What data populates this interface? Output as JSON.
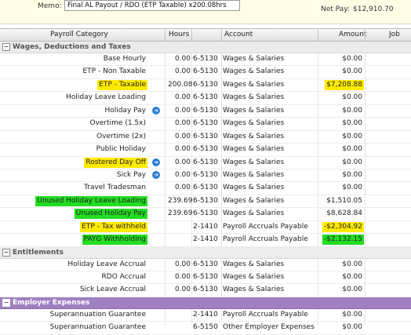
{
  "memo": {
    "label": "Memo:",
    "value": "Final AL Payout / RDO (ETP Taxable) x200.08hrs"
  },
  "net_pay": {
    "label": "Net Pay:",
    "value": "$12,910.70"
  },
  "columns": [
    "Payroll Category",
    "Hours",
    "Account",
    "Amount",
    "Job"
  ],
  "sections": [
    {
      "title": "Wages, Deductions and Taxes",
      "toggle": "−",
      "rows": [
        {
          "category": "Base Hourly",
          "hours": "0.00",
          "acct_no": "6-5130",
          "acct_name": "Wages & Salaries",
          "amount": "$0.00",
          "cat_hl": "",
          "amt_hl": "",
          "info": false
        },
        {
          "category": "ETP - Non Taxable",
          "hours": "0.00",
          "acct_no": "6-5130",
          "acct_name": "Wages & Salaries",
          "amount": "$0.00",
          "cat_hl": "",
          "amt_hl": "",
          "info": false
        },
        {
          "category": "ETP - Taxable",
          "hours": "200.08",
          "acct_no": "6-5130",
          "acct_name": "Wages & Salaries",
          "amount": "$7,208.88",
          "cat_hl": "yellow",
          "amt_hl": "yellow",
          "info": false
        },
        {
          "category": "Holiday Leave Loading",
          "hours": "0.00",
          "acct_no": "6-5130",
          "acct_name": "Wages & Salaries",
          "amount": "$0.00",
          "cat_hl": "",
          "amt_hl": "",
          "info": false
        },
        {
          "category": "Holiday Pay",
          "hours": "0.00",
          "acct_no": "6-5130",
          "acct_name": "Wages & Salaries",
          "amount": "$0.00",
          "cat_hl": "",
          "amt_hl": "",
          "info": true
        },
        {
          "category": "Overtime (1.5x)",
          "hours": "0.00",
          "acct_no": "6-5130",
          "acct_name": "Wages & Salaries",
          "amount": "$0.00",
          "cat_hl": "",
          "amt_hl": "",
          "info": false
        },
        {
          "category": "Overtime (2x)",
          "hours": "0.00",
          "acct_no": "6-5130",
          "acct_name": "Wages & Salaries",
          "amount": "$0.00",
          "cat_hl": "",
          "amt_hl": "",
          "info": false
        },
        {
          "category": "Public Holiday",
          "hours": "0.00",
          "acct_no": "6-5130",
          "acct_name": "Wages & Salaries",
          "amount": "$0.00",
          "cat_hl": "",
          "amt_hl": "",
          "info": false
        },
        {
          "category": "Rostered Day Off",
          "hours": "0.00",
          "acct_no": "6-5130",
          "acct_name": "Wages & Salaries",
          "amount": "$0.00",
          "cat_hl": "yellow",
          "amt_hl": "",
          "info": true
        },
        {
          "category": "Sick Pay",
          "hours": "0.00",
          "acct_no": "6-5130",
          "acct_name": "Wages & Salaries",
          "amount": "$0.00",
          "cat_hl": "",
          "amt_hl": "",
          "info": true
        },
        {
          "category": "Travel Tradesman",
          "hours": "0.00",
          "acct_no": "6-5130",
          "acct_name": "Wages & Salaries",
          "amount": "$0.00",
          "cat_hl": "",
          "amt_hl": "",
          "info": false
        },
        {
          "category": "Unused Holiday Leave Loading",
          "hours": "239.69",
          "acct_no": "6-5130",
          "acct_name": "Wages & Salaries",
          "amount": "$1,510.05",
          "cat_hl": "green",
          "amt_hl": "",
          "info": false
        },
        {
          "category": "Unused Holiday Pay",
          "hours": "239.69",
          "acct_no": "6-5130",
          "acct_name": "Wages & Salaries",
          "amount": "$8,628.84",
          "cat_hl": "green",
          "amt_hl": "",
          "info": false
        },
        {
          "category": "ETP - Tax withheld",
          "hours": "",
          "acct_no": "2-1410",
          "acct_name": "Payroll Accruals Payable",
          "amount": "-$2,304.92",
          "cat_hl": "yellow",
          "amt_hl": "yellow",
          "info": false
        },
        {
          "category": "PAYG Withholding",
          "hours": "",
          "acct_no": "2-1410",
          "acct_name": "Payroll Accruals Payable",
          "amount": "-$2,132.15",
          "cat_hl": "green",
          "amt_hl": "green",
          "info": false
        }
      ]
    },
    {
      "title": "Entitlements",
      "toggle": "−",
      "rows": [
        {
          "category": "Holiday Leave Accrual",
          "hours": "0.00",
          "acct_no": "6-5130",
          "acct_name": "Wages & Salaries",
          "amount": "$0.00",
          "cat_hl": "",
          "amt_hl": "",
          "info": false
        },
        {
          "category": "RDO Accrual",
          "hours": "0.00",
          "acct_no": "6-5130",
          "acct_name": "Wages & Salaries",
          "amount": "$0.00",
          "cat_hl": "",
          "amt_hl": "",
          "info": false
        },
        {
          "category": "Sick Leave Accrual",
          "hours": "0.00",
          "acct_no": "6-5130",
          "acct_name": "Wages & Salaries",
          "amount": "$0.00",
          "cat_hl": "",
          "amt_hl": "",
          "info": false
        }
      ]
    },
    {
      "title": "Employer Expenses",
      "toggle": "−",
      "employer": true,
      "rows": [
        {
          "category": "Superannuation Guarantee",
          "hours": "",
          "acct_no": "2-1410",
          "acct_name": "Payroll Accruals Payable",
          "amount": "$0.00",
          "cat_hl": "",
          "amt_hl": "",
          "info": false
        },
        {
          "category": "Superannuation Guarantee",
          "hours": "",
          "acct_no": "6-5150",
          "acct_name": "Other Employer Expenses",
          "amount": "$0.00",
          "cat_hl": "",
          "amt_hl": "",
          "info": false
        }
      ]
    }
  ],
  "colors": {
    "highlight_yellow": "#ffea00",
    "highlight_green": "#22dd22",
    "employer_section": "#a080c0",
    "info_icon": "#2f7fd0"
  },
  "icons": {
    "info": "arrow-right-circle-icon",
    "collapse": "minus-box-icon"
  }
}
